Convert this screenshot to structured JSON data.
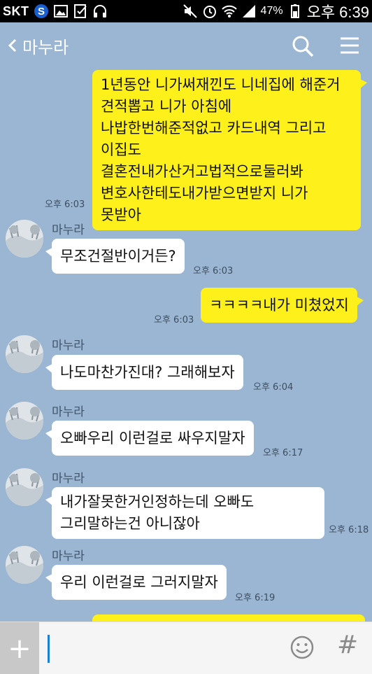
{
  "status_bar": {
    "carrier": "SKT",
    "battery": "47%",
    "time": "오후 6:39"
  },
  "header": {
    "title": "마누라"
  },
  "messages": [
    {
      "from": "me",
      "lines": [
        "1년동안 니가써재낀도 니네집에 해준거",
        "견적뽑고 니가 아침에",
        "나밥한번해준적없고 카드내역 그리고",
        "이집도",
        "결혼전내가산거고법적으로둘러봐",
        "변호사한테도내가받으면받지 니가",
        "못받아"
      ],
      "time": "오후 6:03"
    },
    {
      "from": "other",
      "sender": "마누라",
      "text": "무조건절반이거든?",
      "time": "오후 6:03"
    },
    {
      "from": "me",
      "text": "ㅋㅋㅋㅋ내가 미쳤었지",
      "time": "오후 6:03"
    },
    {
      "from": "other",
      "sender": "마누라",
      "text": "나도마찬가진대? 그래해보자",
      "time": "오후 6:04"
    },
    {
      "from": "other",
      "sender": "마누라",
      "text": "오빠우리 이런걸로 싸우지말자",
      "time": "오후 6:17"
    },
    {
      "from": "other",
      "sender": "마누라",
      "lines": [
        "내가잘못한거인정하는데 오빠도",
        "그리말하는건 아니잖아"
      ],
      "time": "오후 6:18"
    },
    {
      "from": "other",
      "sender": "마누라",
      "text": "우리 이런걸로 그러지말자",
      "time": "오후 6:19"
    }
  ],
  "input": {
    "plus": "+",
    "hash": "#",
    "value": ""
  },
  "colors": {
    "background": "#9bb6d2",
    "my_bubble": "#fef01b",
    "other_bubble": "#ffffff"
  }
}
